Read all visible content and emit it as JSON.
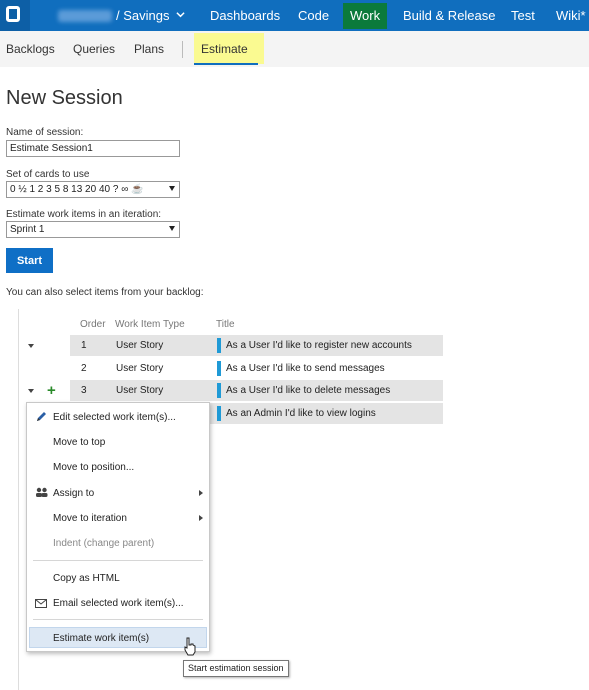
{
  "nav": {
    "project": "/ Savings",
    "items": [
      "Dashboards",
      "Code",
      "Work",
      "Build & Release",
      "Test",
      "Wiki*"
    ],
    "active": "Work"
  },
  "subnav": {
    "items": [
      "Backlogs",
      "Queries",
      "Plans",
      "Estimate"
    ],
    "active": "Estimate"
  },
  "form": {
    "title": "New Session",
    "session_name_label": "Name of session:",
    "session_name_value": "Estimate Session1",
    "cards_label": "Set of cards to use",
    "cards_value": "0 ½ 1 2 3 5 8 13 20 40 ? ∞ ☕",
    "iteration_label": "Estimate work items in an iteration:",
    "iteration_value": "Sprint 1",
    "start_label": "Start"
  },
  "backlog": {
    "intro": "You can also select items from your backlog:",
    "headers": {
      "order": "Order",
      "type": "Work Item Type",
      "title": "Title"
    },
    "rows": [
      {
        "order": "1",
        "type": "User Story",
        "title": "As a User I'd like to register new accounts"
      },
      {
        "order": "2",
        "type": "User Story",
        "title": "As a User I'd like to send messages"
      },
      {
        "order": "3",
        "type": "User Story",
        "title": "As a User I'd like to delete messages"
      },
      {
        "order": "",
        "type": "",
        "title": "As an Admin I'd like to view logins"
      }
    ]
  },
  "context_menu": {
    "items": [
      {
        "label": "Edit selected work item(s)...",
        "icon": "pencil-icon"
      },
      {
        "label": "Move to top"
      },
      {
        "label": "Move to position..."
      },
      {
        "label": "Assign to",
        "icon": "people-icon",
        "submenu": true
      },
      {
        "label": "Move to iteration",
        "submenu": true
      },
      {
        "label": "Indent (change parent)",
        "disabled": true
      },
      {
        "label": "Copy as HTML"
      },
      {
        "label": "Email selected work item(s)...",
        "icon": "envelope-icon"
      },
      {
        "label": "Estimate work item(s)",
        "highlighted": true
      }
    ]
  },
  "tooltip": "Start estimation session",
  "colors": {
    "nav_bg": "#106ebe",
    "nav_active": "#0b7a3b",
    "tab_highlight": "#fafa91",
    "accent": "#1f9ad6"
  }
}
